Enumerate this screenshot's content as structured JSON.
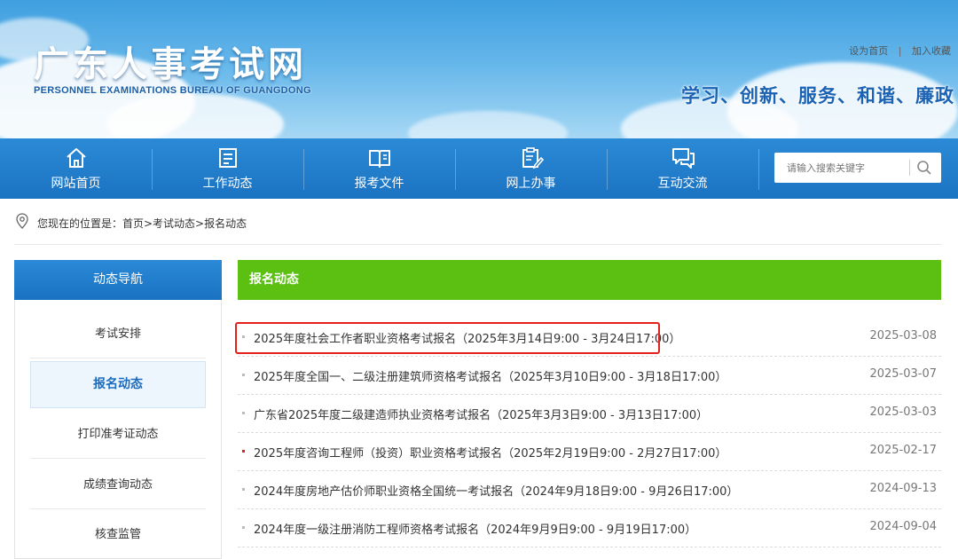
{
  "header": {
    "title": "广东人事考试网",
    "subtitle": "PERSONNEL EXAMINATIONS BUREAU OF GUANGDONG",
    "top_links": [
      "设为首页",
      "加入收藏"
    ],
    "slogan": "学习、创新、服务、和谐、廉政"
  },
  "nav": {
    "items": [
      {
        "label": "网站首页",
        "icon": "home-icon"
      },
      {
        "label": "工作动态",
        "icon": "document-list-icon"
      },
      {
        "label": "报考文件",
        "icon": "book-icon"
      },
      {
        "label": "网上办事",
        "icon": "clipboard-edit-icon"
      },
      {
        "label": "互动交流",
        "icon": "chat-bubbles-icon"
      }
    ],
    "search_placeholder": "请输入搜索关键字"
  },
  "breadcrumb": {
    "text": "您现在的位置是：首页>考试动态>报名动态"
  },
  "sidebar": {
    "heading": "动态导航",
    "items": [
      {
        "label": "考试安排",
        "active": false
      },
      {
        "label": "报名动态",
        "active": true
      },
      {
        "label": "打印准考证动态",
        "active": false
      },
      {
        "label": "成绩查询动态",
        "active": false
      },
      {
        "label": "核查监管",
        "active": false
      }
    ]
  },
  "content": {
    "heading": "报名动态",
    "news": [
      {
        "title": "2025年度社会工作者职业资格考试报名（2025年3月14日9:00 - 3月24日17:00）",
        "date": "2025-03-08",
        "highlighted": true
      },
      {
        "title": "2025年度全国一、二级注册建筑师资格考试报名（2025年3月10日9:00 - 3月18日17:00）",
        "date": "2025-03-07"
      },
      {
        "title": "广东省2025年度二级建造师执业资格考试报名（2025年3月3日9:00 - 3月13日17:00）",
        "date": "2025-03-03"
      },
      {
        "title": "2025年度咨询工程师（投资）职业资格考试报名（2025年2月19日9:00 - 2月27日17:00）",
        "date": "2025-02-17"
      },
      {
        "title": "2024年度房地产估价师职业资格全国统一考试报名（2024年9月18日9:00 - 9月26日17:00）",
        "date": "2024-09-13"
      },
      {
        "title": "2024年度一级注册消防工程师资格考试报名（2024年9月9日9:00 - 9月19日17:00）",
        "date": "2024-09-04"
      }
    ]
  },
  "colors": {
    "nav_blue": "#1b73c2",
    "content_green": "#5cc013",
    "highlight_red": "#e3201c"
  }
}
